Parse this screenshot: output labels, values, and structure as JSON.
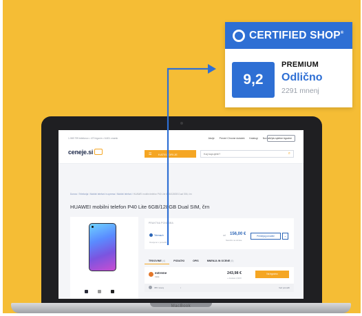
{
  "colors": {
    "background": "#F5BD35",
    "brand_blue": "#2e6fd4",
    "accent_orange": "#F5A623"
  },
  "badge": {
    "title": "CERTIFIED SHOP",
    "trademark": "®",
    "score": "9,2",
    "tier": "PREMIUM",
    "rating_word": "Odlično",
    "reviews": "2291 mnenj",
    "icon": "ring-icon"
  },
  "laptop": {
    "brand": "MacBook"
  },
  "site": {
    "topbar": {
      "stats": "1.069.799 telefonov • 470 trgovin • 6.601 znamk",
      "nav": [
        "Akcije",
        "Preveri Chrome dodatek",
        "Katalogi",
        "Novosti"
      ],
      "login": "Vpis spletne trgovine"
    },
    "logo": "ceneje.si",
    "categories_label": "KATEGORIJE",
    "search": {
      "placeholder": "Kaj kupujete?"
    },
    "breadcrumb": {
      "items": [
        "Domov",
        "Telefonija",
        "Mobilni telefoni in oprema",
        "Mobilni telefoni"
      ],
      "current": "HUAWEI mobilni telefon P40 Lite 6GB/128GB Dual SIM, črn"
    },
    "product_title": "HUAWEI mobilni telefon P40 Lite 6GB/128GB Dual SIM, črn",
    "best_offer": {
      "header": "PRAKTNA PONUDBA",
      "shop": "Telemach",
      "note": "Ocenjeno v ponudbi",
      "from": "od",
      "price": "156,00 €",
      "subtext": "Naročilo na obroke",
      "compare_button": "Primerjaj ponudbe"
    },
    "tabs": [
      {
        "label": "TRGOVINE",
        "count": "(4)"
      },
      {
        "label": "PODATKI",
        "count": ""
      },
      {
        "label": "OPIS",
        "count": ""
      },
      {
        "label": "MNENJA IN OCENE",
        "count": "(0)"
      }
    ],
    "offer": {
      "shop": "extreme",
      "shop_sub": "trade",
      "price": "243,98 €",
      "delivery": "+ dostava 4,99 €",
      "button": "Na trgovino"
    },
    "offer_footer": {
      "opinions": "355 mnenj",
      "more": "Več ponudb"
    }
  }
}
